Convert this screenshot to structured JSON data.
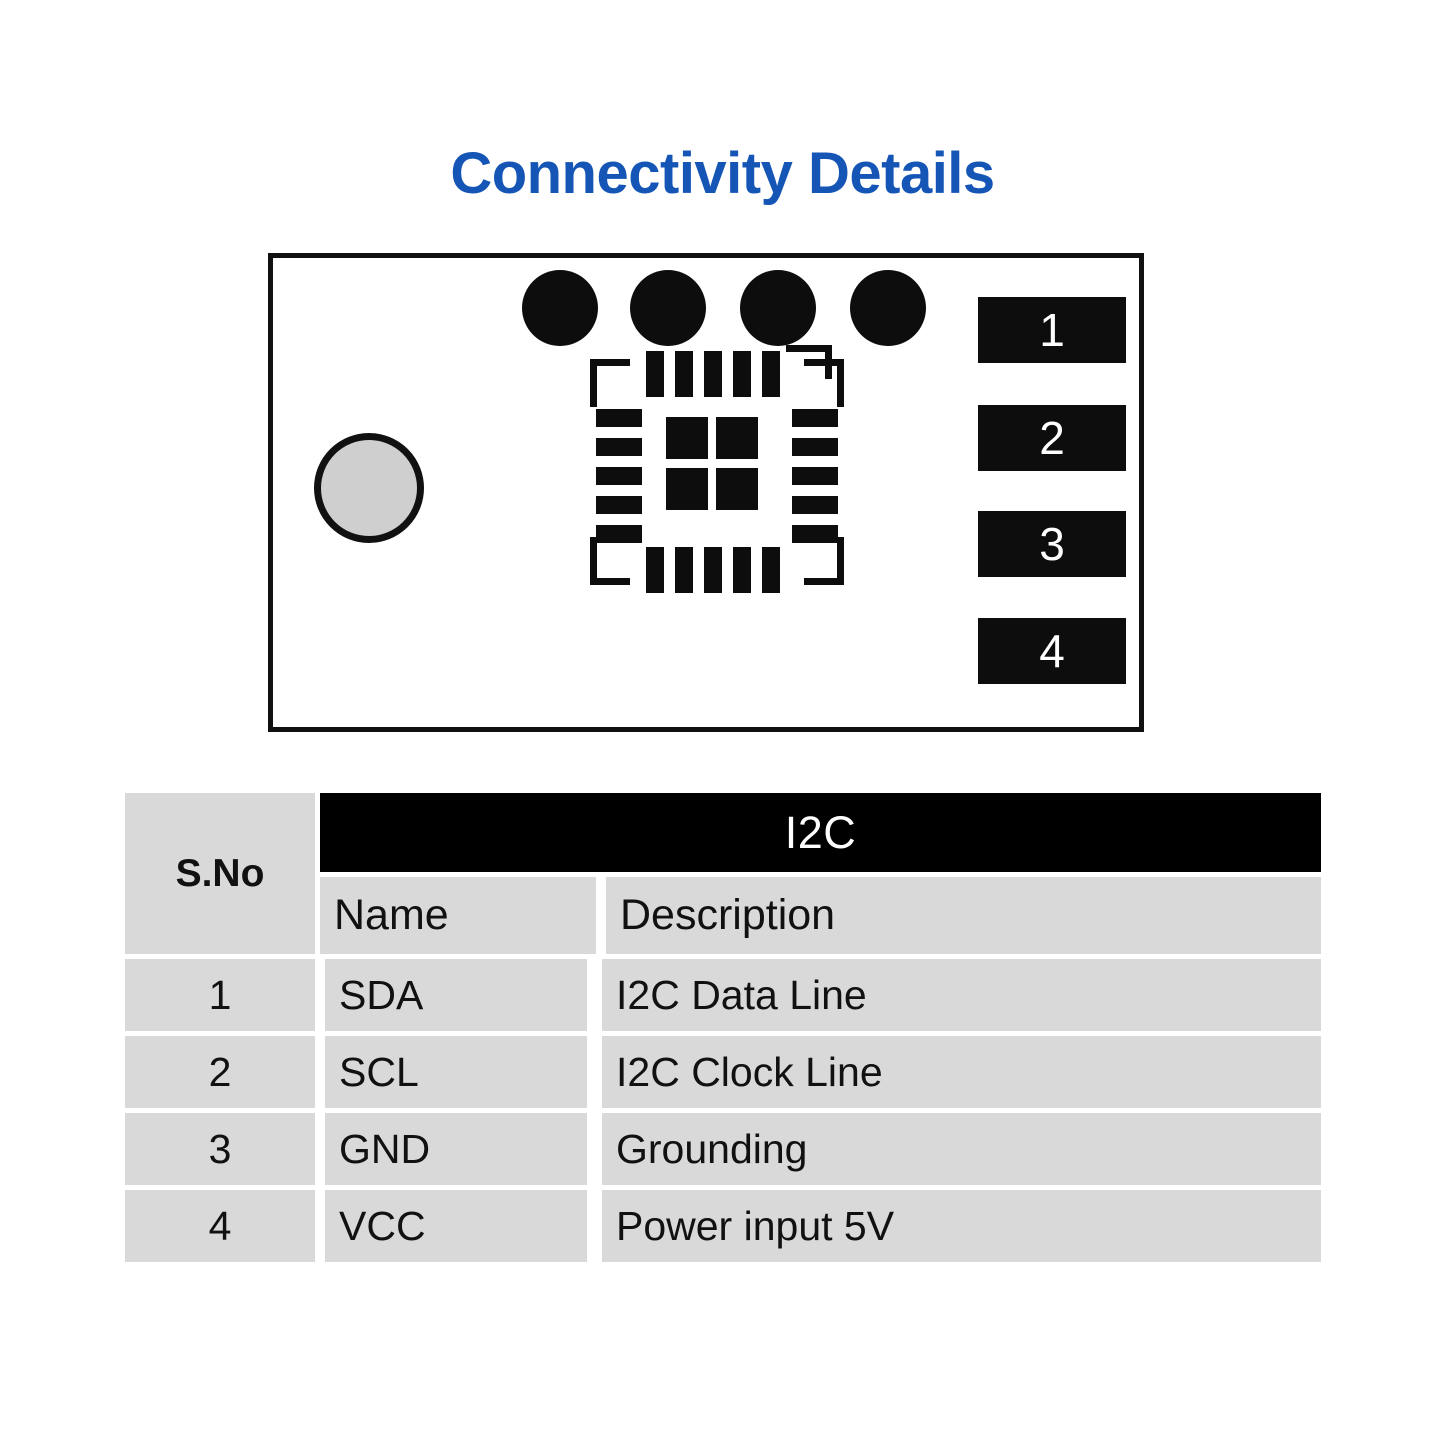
{
  "page": {
    "title": "Connectivity Details",
    "title_color": "#1555b5",
    "background": "#ffffff"
  },
  "board": {
    "name": "pcb-board-diagram",
    "outline_color": "#111111",
    "mounting_hole_color": "#cfcfcf",
    "via_color": "#0d0d0d",
    "vias": [
      1,
      2,
      3,
      4
    ],
    "pin_pads": [
      {
        "number": "1"
      },
      {
        "number": "2"
      },
      {
        "number": "3"
      },
      {
        "number": "4"
      }
    ],
    "chip_footprint": {
      "pads_per_side": 5,
      "center_pads": 4,
      "corner_brackets": 4
    }
  },
  "table": {
    "sno_header": "S.No",
    "group_header": "I2C",
    "columns": [
      "Name",
      "Description"
    ],
    "rows": [
      {
        "sno": "1",
        "name": "SDA",
        "description": "I2C Data Line"
      },
      {
        "sno": "2",
        "name": "SCL",
        "description": "I2C Clock Line"
      },
      {
        "sno": "3",
        "name": "GND",
        "description": "Grounding"
      },
      {
        "sno": "4",
        "name": "VCC",
        "description": "Power input 5V"
      }
    ],
    "cell_color": "#d9d9d9",
    "header_band_color": "#000000"
  }
}
